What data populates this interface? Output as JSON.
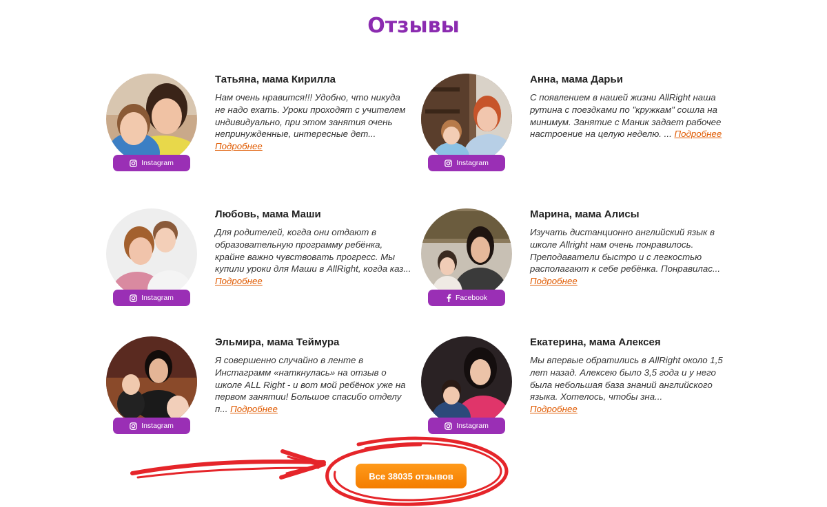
{
  "section_title": "Отзывы",
  "more_label": "Подробнее",
  "cta_label": "Все 38035 отзывов",
  "colors": {
    "accent": "#8b2bb0",
    "badge": "#9a2fb5",
    "link": "#e05a00",
    "button": "#f88a0a",
    "annotation": "#e5252a"
  },
  "reviews": [
    {
      "name": "Татьяна, мама Кирилла",
      "text": "Нам очень нравится!!! Удобно, что никуда не надо ехать. Уроки проходят с учителем индивидуально, при этом занятия очень непринужденные, интересные дет...",
      "social": "Instagram",
      "social_icon": "instagram-icon"
    },
    {
      "name": "Анна, мама Дарьи",
      "text": "С появлением в нашей жизни AllRight наша рутина с поездками по \"кружкам\" сошла на минимум. Занятие с Маник задает рабочее настроение на целую неделю. ...",
      "social": "Instagram",
      "social_icon": "instagram-icon"
    },
    {
      "name": "Любовь, мама Маши",
      "text": "Для родителей, когда они отдают в образовательную программу ребёнка, крайне важно чувствовать прогресс. Мы купили уроки для Маши в AllRight, когда каз...",
      "social": "Instagram",
      "social_icon": "instagram-icon"
    },
    {
      "name": "Марина, мама Алисы",
      "text": "Изучать дистанционно английский язык в школе Allright нам очень понравилось. Преподаватели быстро и с легкостью располагают к себе ребёнка. Понравилас...",
      "social": "Facebook",
      "social_icon": "facebook-icon"
    },
    {
      "name": "Эльмира, мама Теймура",
      "text": "Я совершенно случайно в ленте в Инстаграмм «наткнулась» на отзыв о школе ALL Right - и вот мой ребёнок уже на первом занятии! Большое спасибо отделу п...",
      "social": "Instagram",
      "social_icon": "instagram-icon"
    },
    {
      "name": "Екатерина, мама Алексея",
      "text": "Мы впервые обратились в AllRight около 1,5 лет назад. Алексею было 3,5 года и у него была небольшая база знаний английского языка. Хотелось, чтобы зна...",
      "social": "Instagram",
      "social_icon": "instagram-icon"
    }
  ]
}
